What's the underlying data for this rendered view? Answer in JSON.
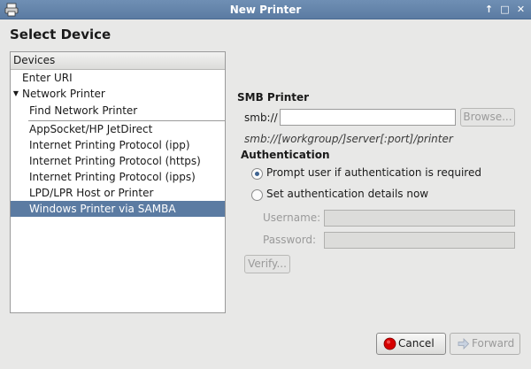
{
  "window": {
    "title": "New Printer",
    "controls": [
      "↑",
      "□",
      "✕"
    ]
  },
  "heading": "Select Device",
  "devices": {
    "header": "Devices",
    "items": [
      {
        "label": "Enter URI",
        "level": 0,
        "expander": ""
      },
      {
        "label": "Network Printer",
        "level": 0,
        "expander": "▼"
      },
      {
        "label": "Find Network Printer",
        "level": 1
      },
      {
        "label": "AppSocket/HP JetDirect",
        "level": 1
      },
      {
        "label": "Internet Printing Protocol (ipp)",
        "level": 1
      },
      {
        "label": "Internet Printing Protocol (https)",
        "level": 1
      },
      {
        "label": "Internet Printing Protocol (ipps)",
        "level": 1
      },
      {
        "label": "LPD/LPR Host or Printer",
        "level": 1
      },
      {
        "label": "Windows Printer via SAMBA",
        "level": 1,
        "selected": true
      }
    ]
  },
  "smb": {
    "title": "SMB Printer",
    "prefix_label": "smb://",
    "uri_value": "",
    "browse_label": "Browse...",
    "format_hint": "smb://[workgroup/]server[:port]/printer"
  },
  "auth": {
    "title": "Authentication",
    "prompt_option": "Prompt user if authentication is required",
    "set_option": "Set authentication details now",
    "selected": "prompt",
    "username_label": "Username:",
    "password_label": "Password:",
    "verify_label": "Verify..."
  },
  "footer": {
    "cancel_label": "Cancel",
    "forward_label": "Forward"
  },
  "colors": {
    "titlebar": "#5b7ba2",
    "selection": "#5b7ba2",
    "cancel_icon": "#d60000"
  }
}
